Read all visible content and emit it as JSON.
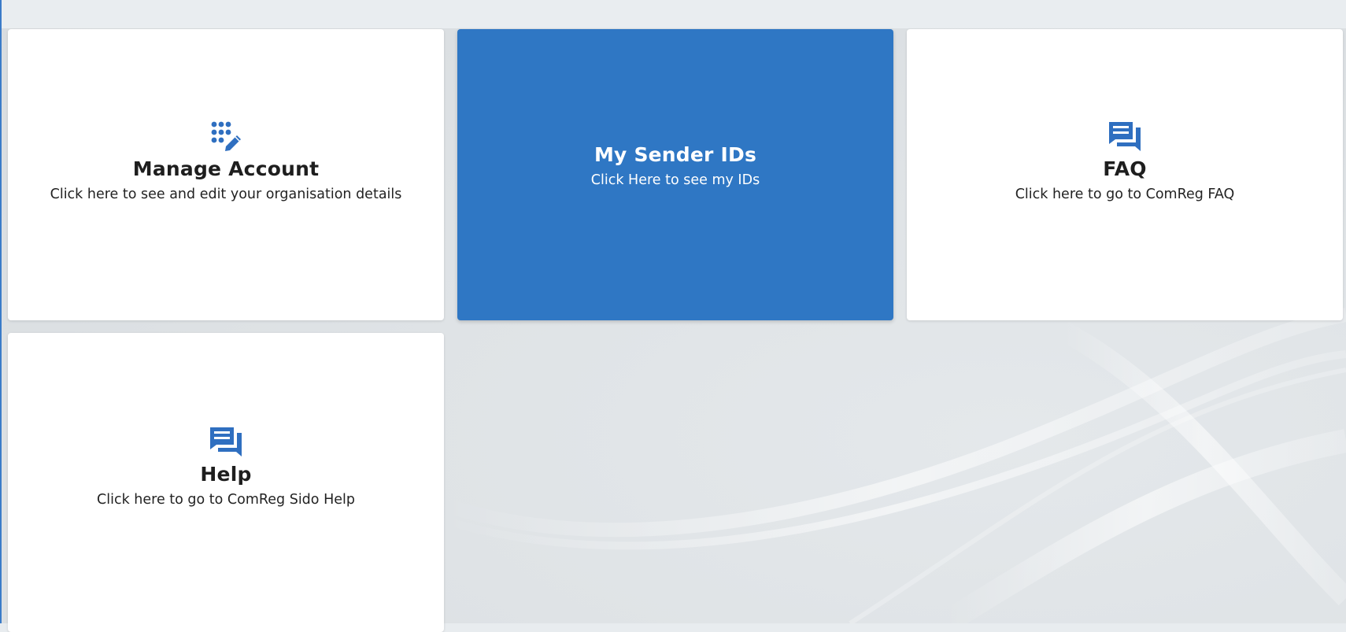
{
  "cards": [
    {
      "id": "manage-account",
      "icon": "dialpad-edit-icon",
      "title": "Manage Account",
      "description": "Click here to see and edit your organisation details"
    },
    {
      "id": "my-sender-ids",
      "icon": "none",
      "title": "My Sender IDs",
      "description": "Click Here to see my IDs",
      "selected": true
    },
    {
      "id": "faq",
      "icon": "chat-bubbles-icon",
      "title": "FAQ",
      "description": "Click here to go to ComReg FAQ"
    },
    {
      "id": "help",
      "icon": "chat-bubbles-icon",
      "title": "Help",
      "description": "Click here to go to ComReg Sido Help"
    }
  ],
  "colors": {
    "accent": "#2f77c4",
    "icon": "#2f6fc0",
    "card_background": "#ffffff",
    "page_background": "#e3e7ea",
    "title_text": "#1e1e1e"
  }
}
